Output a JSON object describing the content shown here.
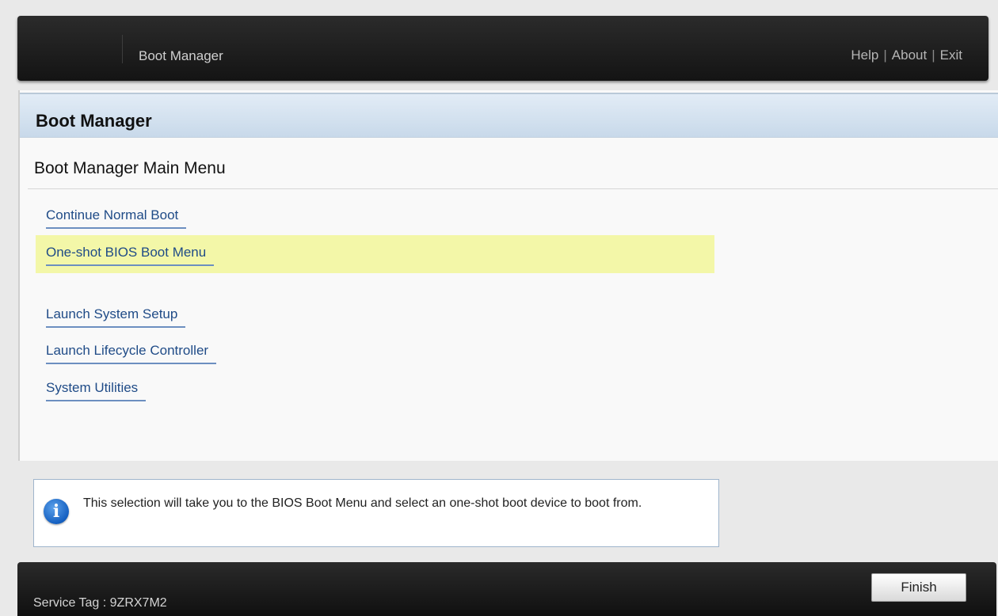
{
  "header": {
    "app_title": "Boot Manager",
    "links": [
      {
        "label": "Help"
      },
      {
        "label": "About"
      },
      {
        "label": "Exit"
      }
    ],
    "separator": "|"
  },
  "panel": {
    "title": "Boot Manager",
    "section_title": "Boot Manager Main Menu",
    "menu_items": [
      {
        "label": "Continue Normal Boot",
        "selected": false
      },
      {
        "label": "One-shot BIOS Boot Menu",
        "selected": true
      },
      {
        "label": "Launch System Setup",
        "selected": false
      },
      {
        "label": "Launch Lifecycle Controller",
        "selected": false
      },
      {
        "label": "System Utilities",
        "selected": false
      }
    ],
    "highlight_color": "#f3f7a8",
    "link_color": "#1f4b87"
  },
  "info": {
    "icon": "info-icon",
    "icon_glyph": "i",
    "text": "This selection will take you to the BIOS Boot Menu and select an one-shot boot device to boot from."
  },
  "footer": {
    "service_tag": "Service Tag : 9ZRX7M2",
    "finish_label": "Finish"
  }
}
